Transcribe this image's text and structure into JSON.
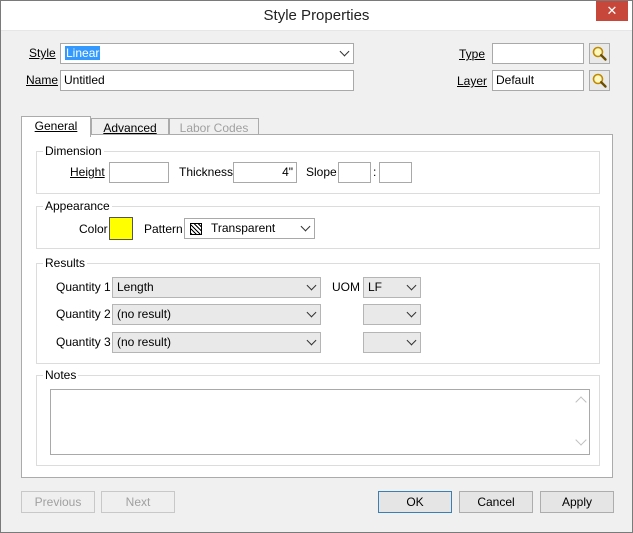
{
  "window": {
    "title": "Style Properties",
    "close_glyph": "✕"
  },
  "header": {
    "style_label": "Style",
    "style_value": "Linear",
    "name_label": "Name",
    "name_value": "Untitled",
    "type_label": "Type",
    "type_value": "",
    "layer_label": "Layer",
    "layer_value": "Default"
  },
  "tabs": [
    {
      "label": "General",
      "active": true
    },
    {
      "label": "Advanced",
      "active": false
    },
    {
      "label": "Labor Codes",
      "disabled": true
    }
  ],
  "dimension": {
    "title": "Dimension",
    "height_label": "Height",
    "height_value": "",
    "thickness_label": "Thickness",
    "thickness_value": "4\"",
    "slope_label": "Slope",
    "slope_value_1": "",
    "slope_sep": ":",
    "slope_value_2": ""
  },
  "appearance": {
    "title": "Appearance",
    "color_label": "Color",
    "color_value": "#ffff00",
    "pattern_label": "Pattern",
    "pattern_value": "Transparent"
  },
  "results": {
    "title": "Results",
    "quantity_1_label": "Quantity 1",
    "quantity_1_value": "Length",
    "quantity_2_label": "Quantity 2",
    "quantity_2_value": "(no result)",
    "quantity_3_label": "Quantity 3",
    "quantity_3_value": "(no result)",
    "uom_label": "UOM",
    "uom_1_value": "LF",
    "uom_2_value": "",
    "uom_3_value": ""
  },
  "notes": {
    "title": "Notes",
    "value": ""
  },
  "footer": {
    "previous_label": "Previous",
    "next_label": "Next",
    "ok_label": "OK",
    "cancel_label": "Cancel",
    "apply_label": "Apply"
  }
}
